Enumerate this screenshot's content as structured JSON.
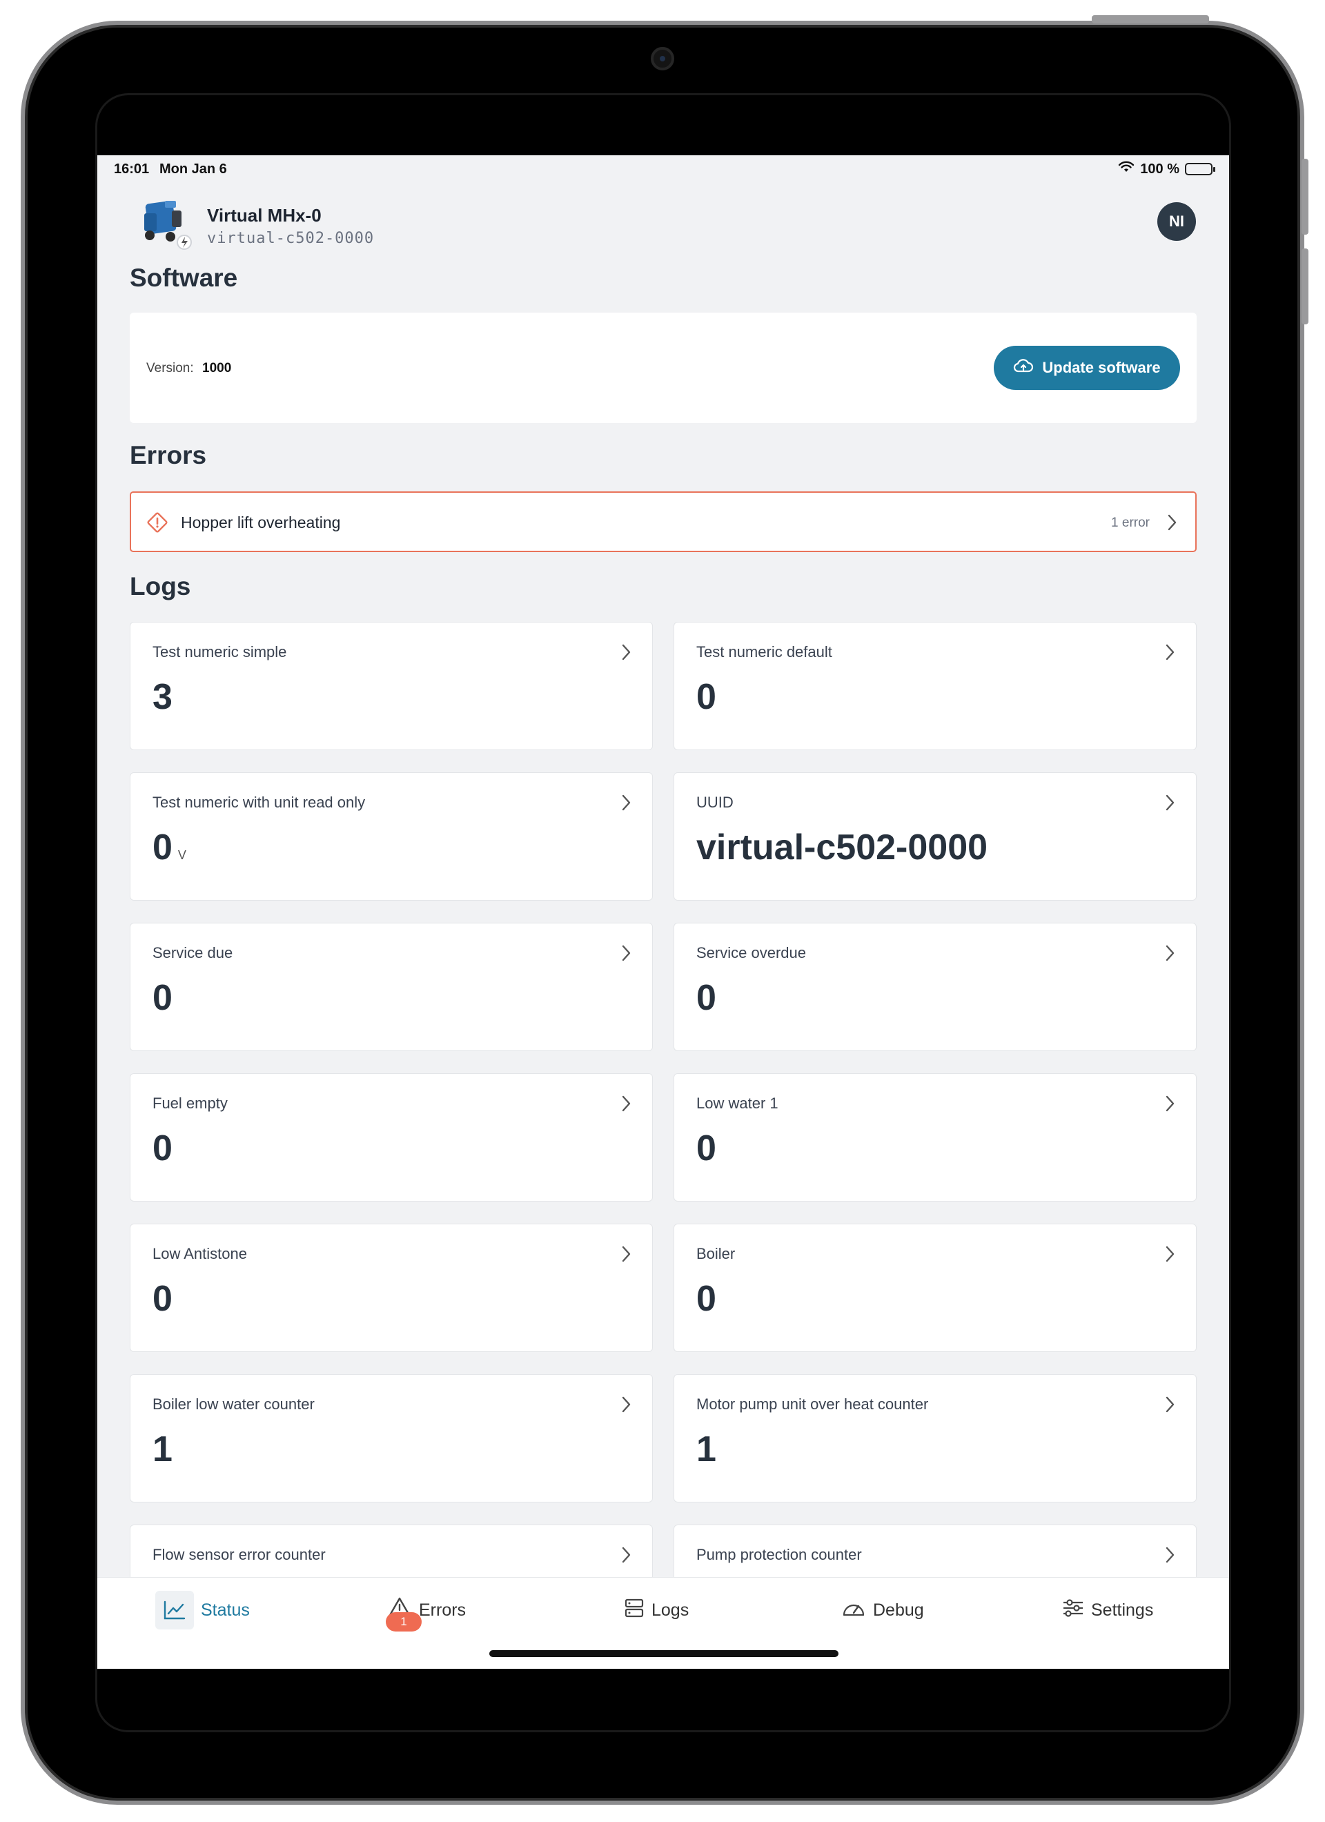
{
  "status_bar": {
    "time": "16:01",
    "date": "Mon Jan 6",
    "battery": "100 %"
  },
  "header": {
    "machine_name": "Virtual MHx-0",
    "machine_id": "virtual-c502-0000",
    "avatar_initials": "NI"
  },
  "software": {
    "title": "Software",
    "version_label": "Version:",
    "version_value": "1000",
    "update_button": "Update software"
  },
  "errors": {
    "title": "Errors",
    "items": [
      {
        "text": "Hopper lift overheating",
        "count": "1 error"
      }
    ]
  },
  "logs": {
    "title": "Logs",
    "items": [
      {
        "label": "Test numeric simple",
        "value": "3",
        "unit": ""
      },
      {
        "label": "Test numeric default",
        "value": "0",
        "unit": ""
      },
      {
        "label": "Test numeric with unit read only",
        "value": "0",
        "unit": "V"
      },
      {
        "label": "UUID",
        "value": "virtual-c502-0000",
        "unit": ""
      },
      {
        "label": "Service due",
        "value": "0",
        "unit": ""
      },
      {
        "label": "Service overdue",
        "value": "0",
        "unit": ""
      },
      {
        "label": "Fuel empty",
        "value": "0",
        "unit": ""
      },
      {
        "label": "Low water 1",
        "value": "0",
        "unit": ""
      },
      {
        "label": "Low Antistone",
        "value": "0",
        "unit": ""
      },
      {
        "label": "Boiler",
        "value": "0",
        "unit": ""
      },
      {
        "label": "Boiler low water counter",
        "value": "1",
        "unit": ""
      },
      {
        "label": "Motor pump unit over heat counter",
        "value": "1",
        "unit": ""
      },
      {
        "label": "Flow sensor error counter",
        "value": "",
        "unit": ""
      },
      {
        "label": "Pump protection counter",
        "value": "",
        "unit": ""
      }
    ]
  },
  "nav": {
    "items": [
      {
        "label": "Status",
        "icon": "chart-line-icon",
        "active": true
      },
      {
        "label": "Errors",
        "icon": "warning-icon",
        "badge": "1"
      },
      {
        "label": "Logs",
        "icon": "server-icon"
      },
      {
        "label": "Debug",
        "icon": "gauge-icon"
      },
      {
        "label": "Settings",
        "icon": "sliders-icon"
      }
    ]
  },
  "colors": {
    "accent": "#1f7aa0",
    "error": "#e9735a",
    "badge": "#ef6b52",
    "background": "#f1f2f4"
  }
}
